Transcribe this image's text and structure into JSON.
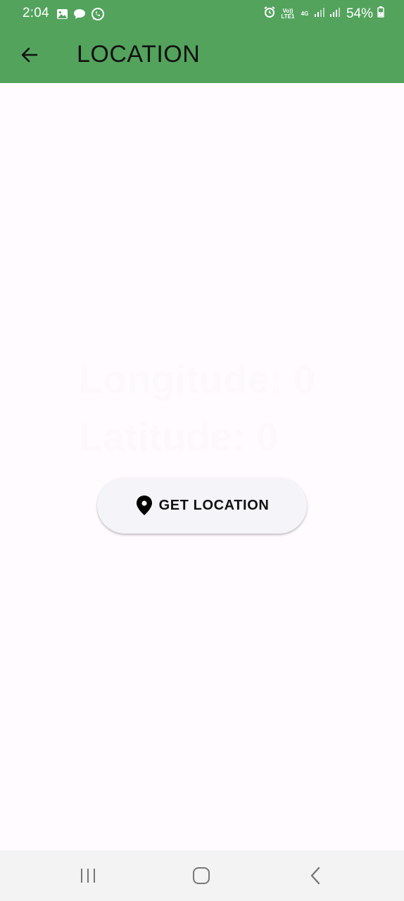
{
  "status_bar": {
    "time": "2:04",
    "battery_percent": "54%",
    "network_volte": "Vo)) LTE1",
    "network_4g": "4G",
    "left_icons": [
      "image-icon",
      "message-icon",
      "whatsapp-icon"
    ],
    "right_icons": [
      "alarm-icon",
      "signal-icon",
      "signal-icon",
      "battery-icon"
    ]
  },
  "app_bar": {
    "title": "LOCATION",
    "background_color": "#53a35d"
  },
  "location": {
    "longitude_label": "Longitude:",
    "longitude_value": "0",
    "latitude_label": "Latitude:",
    "latitude_value": "0"
  },
  "actions": {
    "get_location_label": "GET LOCATION",
    "get_location_icon": "location-pin-icon"
  },
  "nav_bar": {
    "buttons": [
      "recents-icon",
      "home-icon",
      "back-icon"
    ]
  }
}
